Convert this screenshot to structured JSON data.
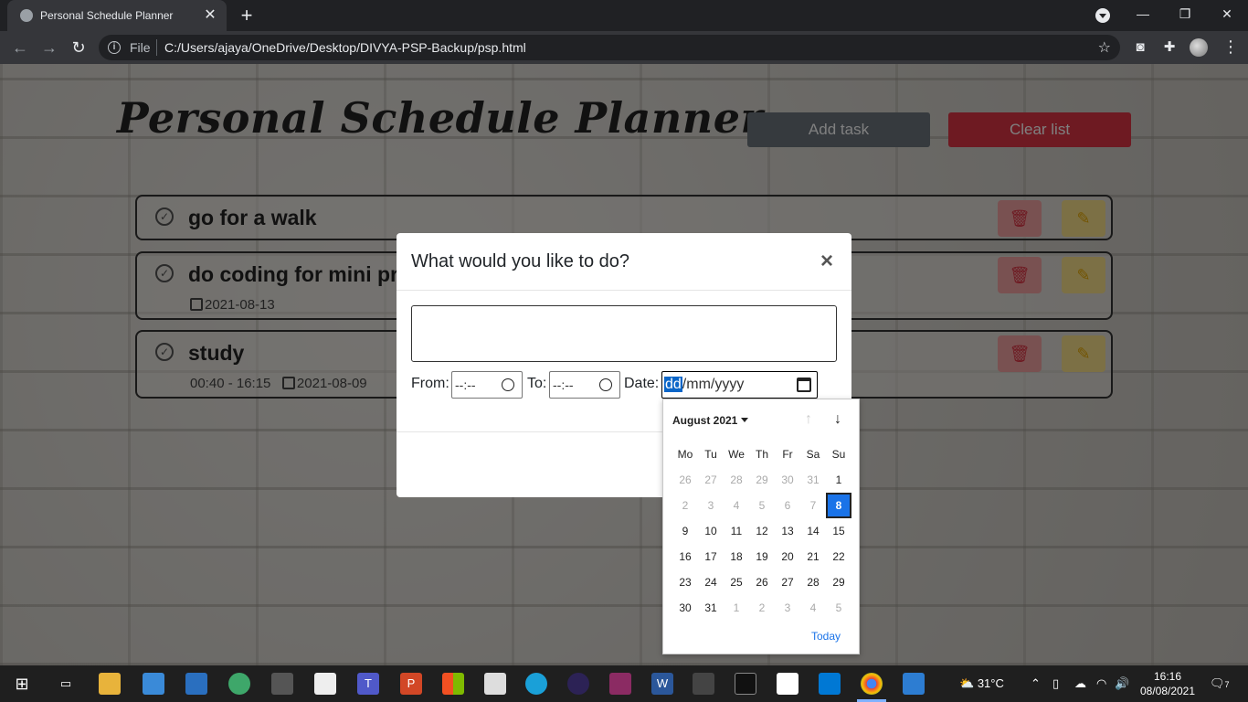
{
  "browser": {
    "tab_title": "Personal Schedule Planner",
    "address_scheme": "File",
    "address_url": "C:/Users/ajaya/OneDrive/Desktop/DIVYA-PSP-Backup/psp.html"
  },
  "page": {
    "title": "Personal Schedule Planner",
    "add_label": "Add task",
    "clear_label": "Clear list",
    "tasks": [
      {
        "title": "go for a walk",
        "time": "",
        "date": ""
      },
      {
        "title": "do coding for mini pr",
        "time": "",
        "date": "2021-08-13"
      },
      {
        "title": "study",
        "time": "00:40 - 16:15",
        "date": "2021-08-09"
      }
    ]
  },
  "modal": {
    "title": "What would you like to do?",
    "close": "×",
    "task_value": "",
    "from_label": "From:",
    "from_value": "--:--",
    "to_label": "To:",
    "to_value": "--:--",
    "date_label": "Date:",
    "date_dd": "dd",
    "date_rest": "/mm/yyyy"
  },
  "datepicker": {
    "month": "August 2021",
    "weekdays": [
      "Mo",
      "Tu",
      "We",
      "Th",
      "Fr",
      "Sa",
      "Su"
    ],
    "weeks": [
      [
        "26",
        "27",
        "28",
        "29",
        "30",
        "31",
        "1"
      ],
      [
        "2",
        "3",
        "4",
        "5",
        "6",
        "7",
        "8"
      ],
      [
        "9",
        "10",
        "11",
        "12",
        "13",
        "14",
        "15"
      ],
      [
        "16",
        "17",
        "18",
        "19",
        "20",
        "21",
        "22"
      ],
      [
        "23",
        "24",
        "25",
        "26",
        "27",
        "28",
        "29"
      ],
      [
        "30",
        "31",
        "1",
        "2",
        "3",
        "4",
        "5"
      ]
    ],
    "selected": "8",
    "today_label": "Today"
  },
  "taskbar": {
    "weather": "31°C",
    "time": "16:16",
    "date": "08/08/2021",
    "notifications": "7"
  },
  "colors": {
    "add_button": "#6c757d",
    "clear_button": "#dc3545",
    "selected_day": "#1a73e8"
  }
}
